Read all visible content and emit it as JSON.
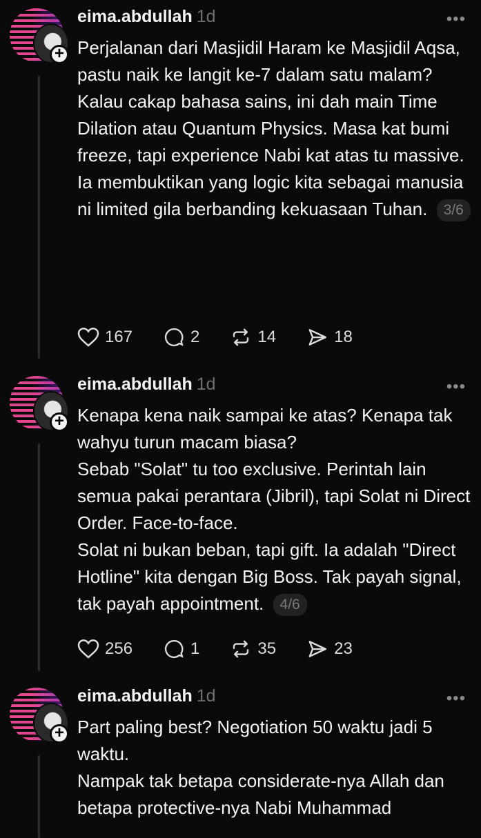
{
  "posts": [
    {
      "username": "eima.abdullah",
      "time": "1d",
      "more_icon": "more-horizontal-icon",
      "lines": [
        "Perjalanan dari Masjidil Haram ke Masjidil Aqsa, pastu naik ke langit ke-7 dalam satu malam?",
        "Kalau cakap bahasa sains, ini dah main Time Dilation atau Quantum Physics. Masa kat bumi freeze, tapi experience Nabi kat atas tu massive.",
        "Ia membuktikan yang logic kita sebagai manusia ni limited gila berbanding kekuasaan Tuhan."
      ],
      "thread_count": "3/6",
      "likes": "167",
      "replies": "2",
      "reposts": "14",
      "shares": "18"
    },
    {
      "username": "eima.abdullah",
      "time": "1d",
      "more_icon": "more-horizontal-icon",
      "lines": [
        "Kenapa kena naik sampai ke atas? Kenapa tak wahyu turun macam biasa?",
        "Sebab \"Solat\" tu too exclusive. Perintah lain semua pakai perantara (Jibril), tapi Solat ni Direct Order. Face-to-face.",
        "Solat ni bukan beban, tapi gift. Ia adalah \"Direct Hotline\" kita dengan Big Boss. Tak payah signal, tak payah appointment."
      ],
      "thread_count": "4/6",
      "likes": "256",
      "replies": "1",
      "reposts": "35",
      "shares": "23"
    },
    {
      "username": "eima.abdullah",
      "time": "1d",
      "more_icon": "more-horizontal-icon",
      "lines": [
        "Part paling best? Negotiation 50 waktu jadi 5 waktu.",
        "Nampak tak betapa considerate-nya Allah dan betapa protective-nya Nabi Muhammad"
      ]
    }
  ],
  "icons": {
    "like": "heart-icon",
    "reply": "comment-icon",
    "repost": "repost-icon",
    "share": "send-icon",
    "follow": "plus-icon"
  },
  "colors": {
    "background": "#0a0a0a",
    "text": "#f3f3f3",
    "muted": "#6f6f6f",
    "avatar_ring": "#e4488e"
  }
}
